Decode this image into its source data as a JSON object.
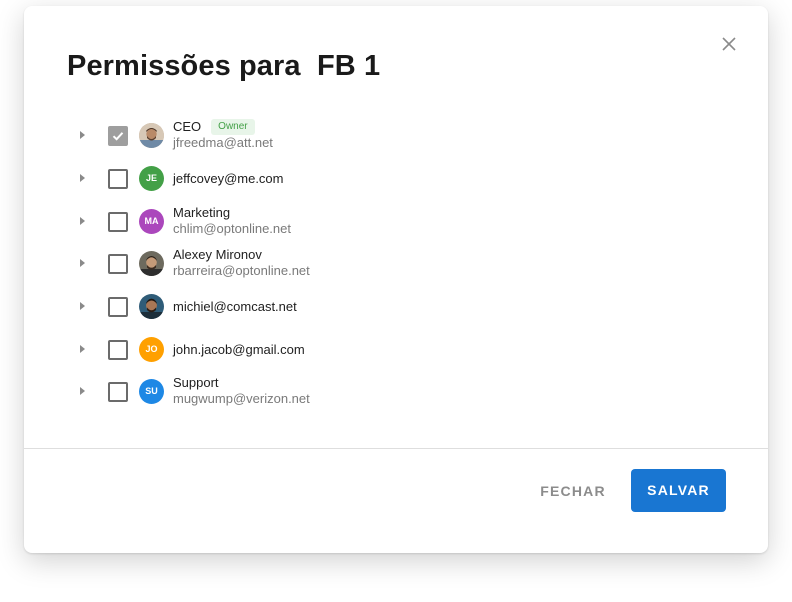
{
  "dialog": {
    "title": "Permissões para  FB 1",
    "close_icon": "close-icon"
  },
  "colors": {
    "primary": "#1976d2",
    "owner_badge_text": "#43a047",
    "owner_badge_bg": "#e8f5e9"
  },
  "users": [
    {
      "name": "CEO",
      "badge": "Owner",
      "email": "jfreedma@att.net",
      "checked": true,
      "avatar_type": "photo"
    },
    {
      "name": "",
      "email": "jeffcovey@me.com",
      "checked": false,
      "avatar_type": "initials",
      "initials": "JE",
      "avatar_color": "#43a047"
    },
    {
      "name": "Marketing",
      "email": "chlim@optonline.net",
      "checked": false,
      "avatar_type": "initials",
      "initials": "MA",
      "avatar_color": "#ab47bc"
    },
    {
      "name": "Alexey Mironov",
      "email": "rbarreira@optonline.net",
      "checked": false,
      "avatar_type": "photo"
    },
    {
      "name": "",
      "email": "michiel@comcast.net",
      "checked": false,
      "avatar_type": "photo"
    },
    {
      "name": "",
      "email": "john.jacob@gmail.com",
      "checked": false,
      "avatar_type": "initials",
      "initials": "JO",
      "avatar_color": "#ffa000"
    },
    {
      "name": "Support",
      "email": "mugwump@verizon.net",
      "checked": false,
      "avatar_type": "initials",
      "initials": "SU",
      "avatar_color": "#1e88e5"
    }
  ],
  "footer": {
    "close_label": "FECHAR",
    "save_label": "SALVAR"
  }
}
